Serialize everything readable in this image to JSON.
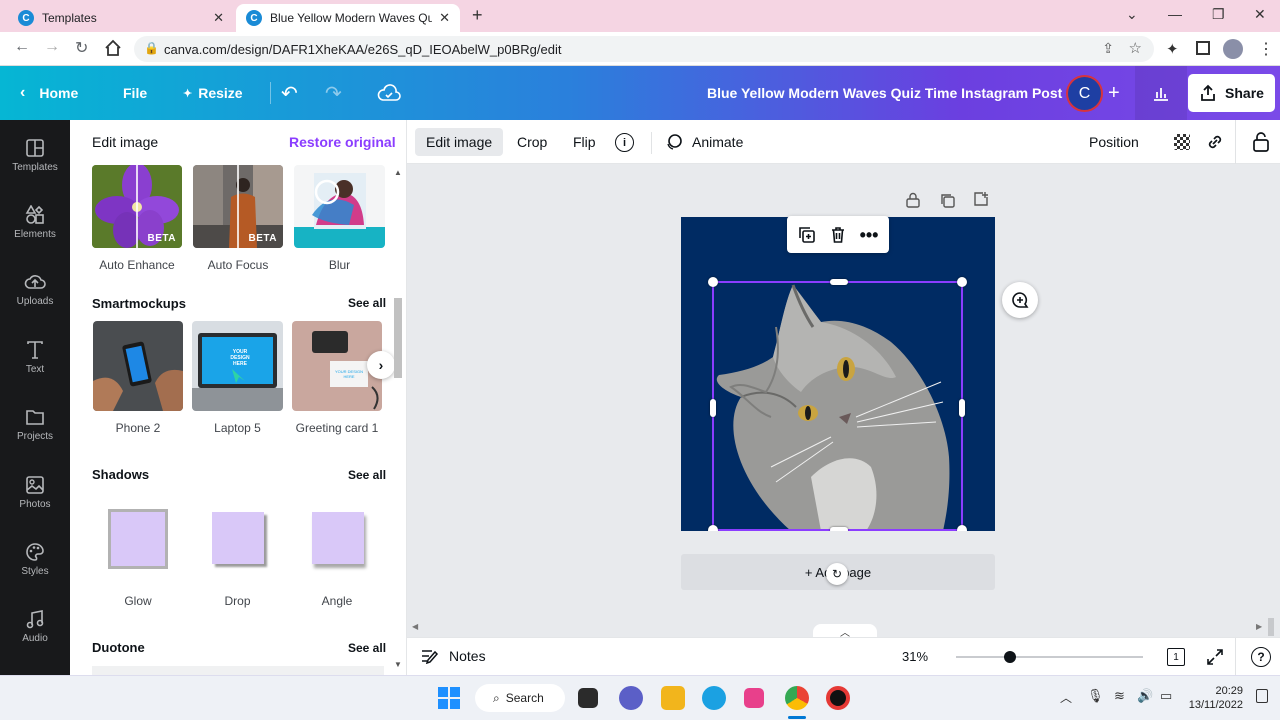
{
  "browser": {
    "tabs": [
      {
        "title": "Templates",
        "active": false
      },
      {
        "title": "Blue Yellow Modern Waves Quiz",
        "active": true
      }
    ],
    "url": "canva.com/design/DAFR1XheKAA/e26S_qD_IEOAbelW_p0BRg/edit"
  },
  "topbar": {
    "home": "Home",
    "file": "File",
    "resize": "Resize",
    "title": "Blue Yellow Modern Waves Quiz Time Instagram Post",
    "avatar_letter": "C",
    "share": "Share"
  },
  "sidebar": {
    "items": [
      {
        "label": "Templates",
        "icon": "templates-icon"
      },
      {
        "label": "Elements",
        "icon": "elements-icon"
      },
      {
        "label": "Uploads",
        "icon": "uploads-icon"
      },
      {
        "label": "Text",
        "icon": "text-icon"
      },
      {
        "label": "Projects",
        "icon": "projects-icon"
      },
      {
        "label": "Photos",
        "icon": "photos-icon"
      },
      {
        "label": "Styles",
        "icon": "styles-icon"
      },
      {
        "label": "Audio",
        "icon": "audio-icon"
      }
    ]
  },
  "panel": {
    "header": "Edit image",
    "restore": "Restore original",
    "effects": [
      {
        "label": "Auto Enhance",
        "badge": "BETA"
      },
      {
        "label": "Auto Focus",
        "badge": "BETA"
      },
      {
        "label": "Blur",
        "badge": ""
      }
    ],
    "smartmockups": {
      "title": "Smartmockups",
      "see_all": "See all",
      "items": [
        "Phone 2",
        "Laptop 5",
        "Greeting card 1"
      ],
      "laptop_text": "YOUR DESIGN HERE",
      "card_text": "YOUR DESIGN HERE"
    },
    "shadows": {
      "title": "Shadows",
      "see_all": "See all",
      "items": [
        "Glow",
        "Drop",
        "Angle"
      ]
    },
    "duotone": {
      "title": "Duotone",
      "see_all": "See all"
    }
  },
  "toolbar": {
    "edit_image": "Edit image",
    "crop": "Crop",
    "flip": "Flip",
    "animate": "Animate",
    "position": "Position"
  },
  "canvas": {
    "add_page": "+ Add page",
    "page_bg": "#002b63"
  },
  "footer": {
    "notes": "Notes",
    "zoom": "31%",
    "zoom_fraction": 0.29,
    "page_count": "1"
  },
  "taskbar": {
    "search": "Search",
    "time": "20:29",
    "date": "13/11/2022"
  },
  "colors": {
    "accent": "#8b3dff",
    "shadow_swatch": "#d9c8f8"
  }
}
